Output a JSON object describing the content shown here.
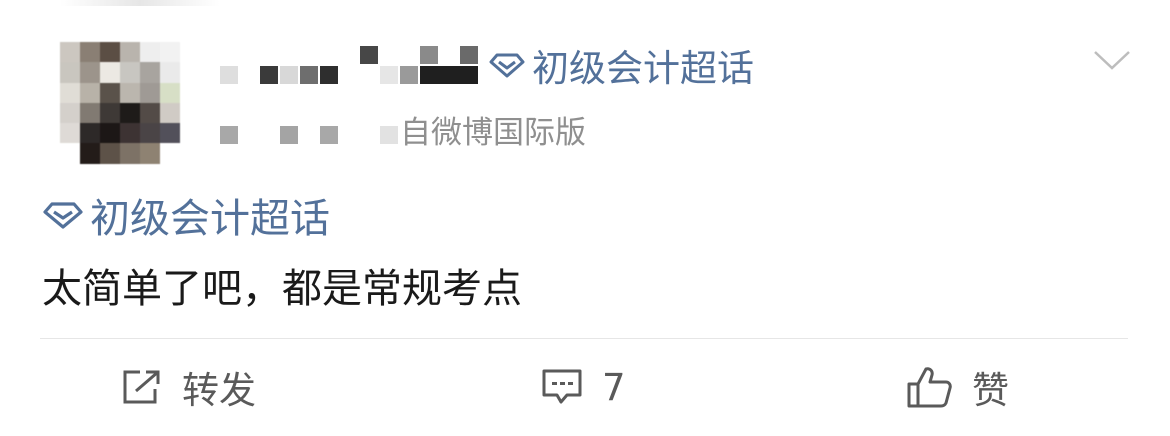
{
  "post": {
    "author": {
      "avatar_colors": [
        "#ccc7c0",
        "#8a7f74",
        "#5b4e44",
        "#b9b4ad",
        "#eeeeee",
        "#f2f2f2",
        "#c9c6bf",
        "#9c948b",
        "#ece9e3",
        "#c8c6c1",
        "#a8a49f",
        "#eaeaea",
        "#e0ddd6",
        "#b8b2a8",
        "#5a524a",
        "#bbb6ae",
        "#9f9a95",
        "#d7dfc6",
        "#d4d0cb",
        "#817a72",
        "#3e3936",
        "#1e1b19",
        "#534b47",
        "#d0cbc5",
        "#dedad6",
        "#2d2928",
        "#1c1716",
        "#3d3333",
        "#4a4446",
        "#52505a",
        "#ffffff",
        "#231c19",
        "#5d5248",
        "#7d7266",
        "#8e8272",
        "#ffffff"
      ]
    },
    "header_topic": "初级会计超话",
    "source": "自微博国际版",
    "body_topic": "初级会计超话",
    "body_text": "太简单了吧，都是常规考点"
  },
  "actions": {
    "repost_label": "转发",
    "comment_count": "7",
    "like_label": "赞"
  },
  "colors": {
    "topic_blue": "#53719a",
    "body_text": "#1a1a1a",
    "meta_gray": "#8f8f8f",
    "action_gray": "#5a5a5a",
    "divider": "#e6e6e6"
  },
  "icons": {
    "topic": "diamond-icon",
    "menu": "chevron-down-icon",
    "repost": "share-arrow-icon",
    "comment": "comment-bubble-icon",
    "like": "thumbs-up-icon"
  }
}
